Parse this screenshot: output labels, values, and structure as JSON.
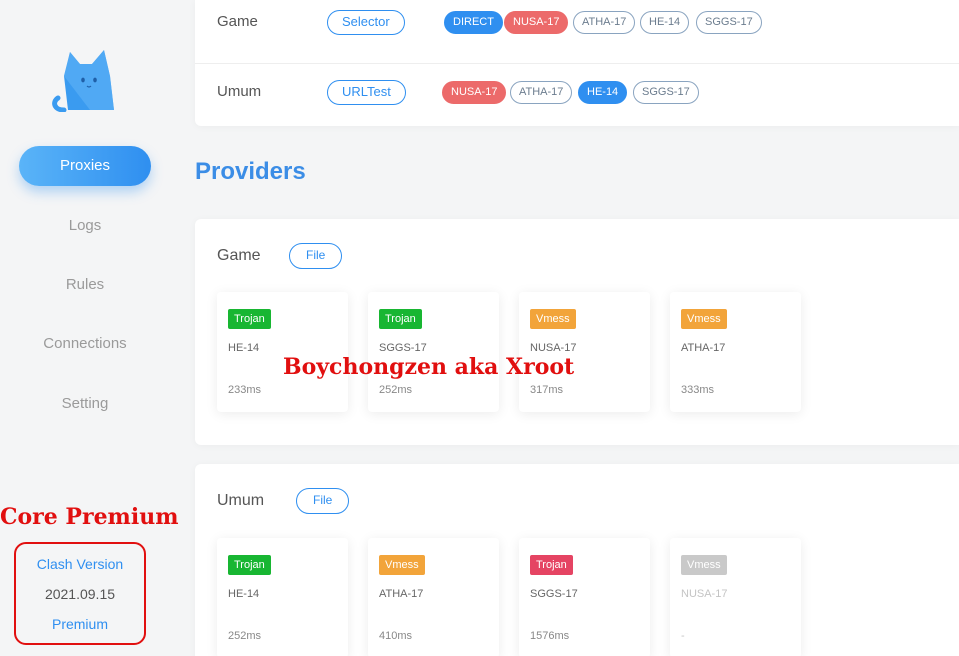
{
  "sidebar": {
    "nav": [
      "Proxies",
      "Logs",
      "Rules",
      "Connections",
      "Setting"
    ],
    "active": "Proxies",
    "core_label": "Core Premium",
    "version": {
      "label": "Clash Version",
      "value": "2021.09.15",
      "edition": "Premium"
    }
  },
  "groups": [
    {
      "name": "Game",
      "type": "Selector",
      "tags": [
        {
          "label": "DIRECT",
          "style": "blue"
        },
        {
          "label": "NUSA-17",
          "style": "red"
        },
        {
          "label": "ATHA-17",
          "style": "outline"
        },
        {
          "label": "HE-14",
          "style": "outline"
        },
        {
          "label": "SGGS-17",
          "style": "outline"
        }
      ]
    },
    {
      "name": "Umum",
      "type": "URLTest",
      "tags": [
        {
          "label": "NUSA-17",
          "style": "red"
        },
        {
          "label": "ATHA-17",
          "style": "outline"
        },
        {
          "label": "HE-14",
          "style": "blue"
        },
        {
          "label": "SGGS-17",
          "style": "outline"
        }
      ]
    }
  ],
  "providers_title": "Providers",
  "providers": [
    {
      "name": "Game",
      "type": "File",
      "proxies": [
        {
          "protocol": "Trojan",
          "badge": "trojan",
          "name": "HE-14",
          "delay": "233ms"
        },
        {
          "protocol": "Trojan",
          "badge": "trojan",
          "name": "SGGS-17",
          "delay": "252ms"
        },
        {
          "protocol": "Vmess",
          "badge": "vmess",
          "name": "NUSA-17",
          "delay": "317ms"
        },
        {
          "protocol": "Vmess",
          "badge": "vmess",
          "name": "ATHA-17",
          "delay": "333ms"
        }
      ]
    },
    {
      "name": "Umum",
      "type": "File",
      "proxies": [
        {
          "protocol": "Trojan",
          "badge": "trojan",
          "name": "HE-14",
          "delay": "252ms"
        },
        {
          "protocol": "Vmess",
          "badge": "vmess",
          "name": "ATHA-17",
          "delay": "410ms"
        },
        {
          "protocol": "Trojan",
          "badge": "trojan-red",
          "name": "SGGS-17",
          "delay": "1576ms"
        },
        {
          "protocol": "Vmess",
          "badge": "gray",
          "name": "NUSA-17",
          "delay": "-"
        }
      ]
    }
  ],
  "watermark": "Boychongzen aka Xroot",
  "colors": {
    "accent": "#2f8ff0",
    "title": "#3b8de6",
    "annotation_red": "#e10f0f",
    "trojan": "#18b632",
    "vmess": "#f2a43a",
    "trojan_slow": "#e54463",
    "tag_red": "#ec6a6a"
  }
}
